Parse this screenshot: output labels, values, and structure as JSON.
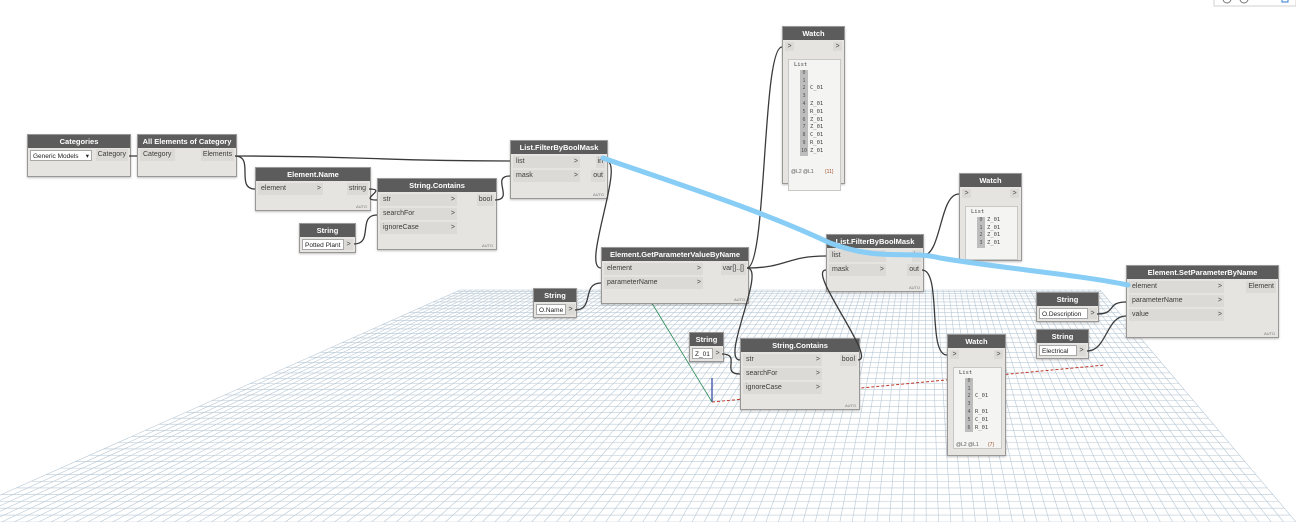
{
  "nodes": {
    "categories": {
      "title": "Categories",
      "dropdown_value": "Generic Models",
      "output": "Category"
    },
    "all_elements": {
      "title": "All Elements of Category",
      "input": "Category",
      "output": "Elements"
    },
    "element_name": {
      "title": "Element.Name",
      "input": "element",
      "output": "string",
      "auto": "AUTO"
    },
    "string_contains_1": {
      "title": "String.Contains",
      "inputs": [
        "str",
        "searchFor",
        "ignoreCase"
      ],
      "output": "bool",
      "auto": "AUTO"
    },
    "string_potted": {
      "title": "String",
      "value": "Potted Plant"
    },
    "filter_1": {
      "title": "List.FilterByBoolMask",
      "inputs": [
        "list",
        "mask"
      ],
      "outputs": [
        "in",
        "out"
      ],
      "auto": "AUTO"
    },
    "get_param": {
      "title": "Element.GetParameterValueByName",
      "inputs": [
        "element",
        "parameterName"
      ],
      "output": "var[]..[]",
      "auto": "AUTO"
    },
    "string_oname": {
      "title": "String",
      "value": "O.Name"
    },
    "watch_1": {
      "title": "Watch",
      "list_label": "List",
      "rows": [
        {
          "i": "0",
          "v": ""
        },
        {
          "i": "1",
          "v": ""
        },
        {
          "i": "2",
          "v": "C_01"
        },
        {
          "i": "3",
          "v": ""
        },
        {
          "i": "4",
          "v": "Z_01"
        },
        {
          "i": "5",
          "v": "R_01"
        },
        {
          "i": "6",
          "v": "Z_01"
        },
        {
          "i": "7",
          "v": "Z_01"
        },
        {
          "i": "8",
          "v": "C_01"
        },
        {
          "i": "9",
          "v": "R_01"
        },
        {
          "i": "10",
          "v": "Z_01"
        }
      ],
      "footer_left": "@L2 @L1",
      "footer_right": "{11}"
    },
    "filter_2": {
      "title": "List.FilterByBoolMask",
      "inputs": [
        "list",
        "mask"
      ],
      "outputs": [
        "in",
        "out"
      ],
      "auto": "AUTO"
    },
    "watch_2": {
      "title": "Watch",
      "list_label": "List",
      "rows": [
        {
          "i": "0",
          "v": "Z_01"
        },
        {
          "i": "1",
          "v": "Z_01"
        },
        {
          "i": "2",
          "v": "Z_01"
        },
        {
          "i": "3",
          "v": "Z_01"
        }
      ]
    },
    "string_z01": {
      "title": "String",
      "value": "Z_01"
    },
    "string_contains_2": {
      "title": "String.Contains",
      "inputs": [
        "str",
        "searchFor",
        "ignoreCase"
      ],
      "output": "bool",
      "auto": "AUTO"
    },
    "watch_3": {
      "title": "Watch",
      "list_label": "List",
      "rows": [
        {
          "i": "0",
          "v": ""
        },
        {
          "i": "1",
          "v": ""
        },
        {
          "i": "2",
          "v": "C_01"
        },
        {
          "i": "3",
          "v": ""
        },
        {
          "i": "4",
          "v": "R_01"
        },
        {
          "i": "5",
          "v": "C_01"
        },
        {
          "i": "6",
          "v": "R_01"
        }
      ],
      "footer_left": "@L2 @L1",
      "footer_right": "{7}"
    },
    "set_param": {
      "title": "Element.SetParameterByName",
      "inputs": [
        "element",
        "parameterName",
        "value"
      ],
      "output": "Element",
      "auto": "AUTO"
    },
    "string_odesc": {
      "title": "String",
      "value": "O.Description"
    },
    "string_elec": {
      "title": "String",
      "value": "Electrical"
    }
  },
  "colors": {
    "node_header": "#5c5c5c",
    "node_body": "#e6e4e1",
    "wire": "#3a3a3a",
    "highlight": "#87cdf5",
    "grid": "#b9c9d6"
  }
}
